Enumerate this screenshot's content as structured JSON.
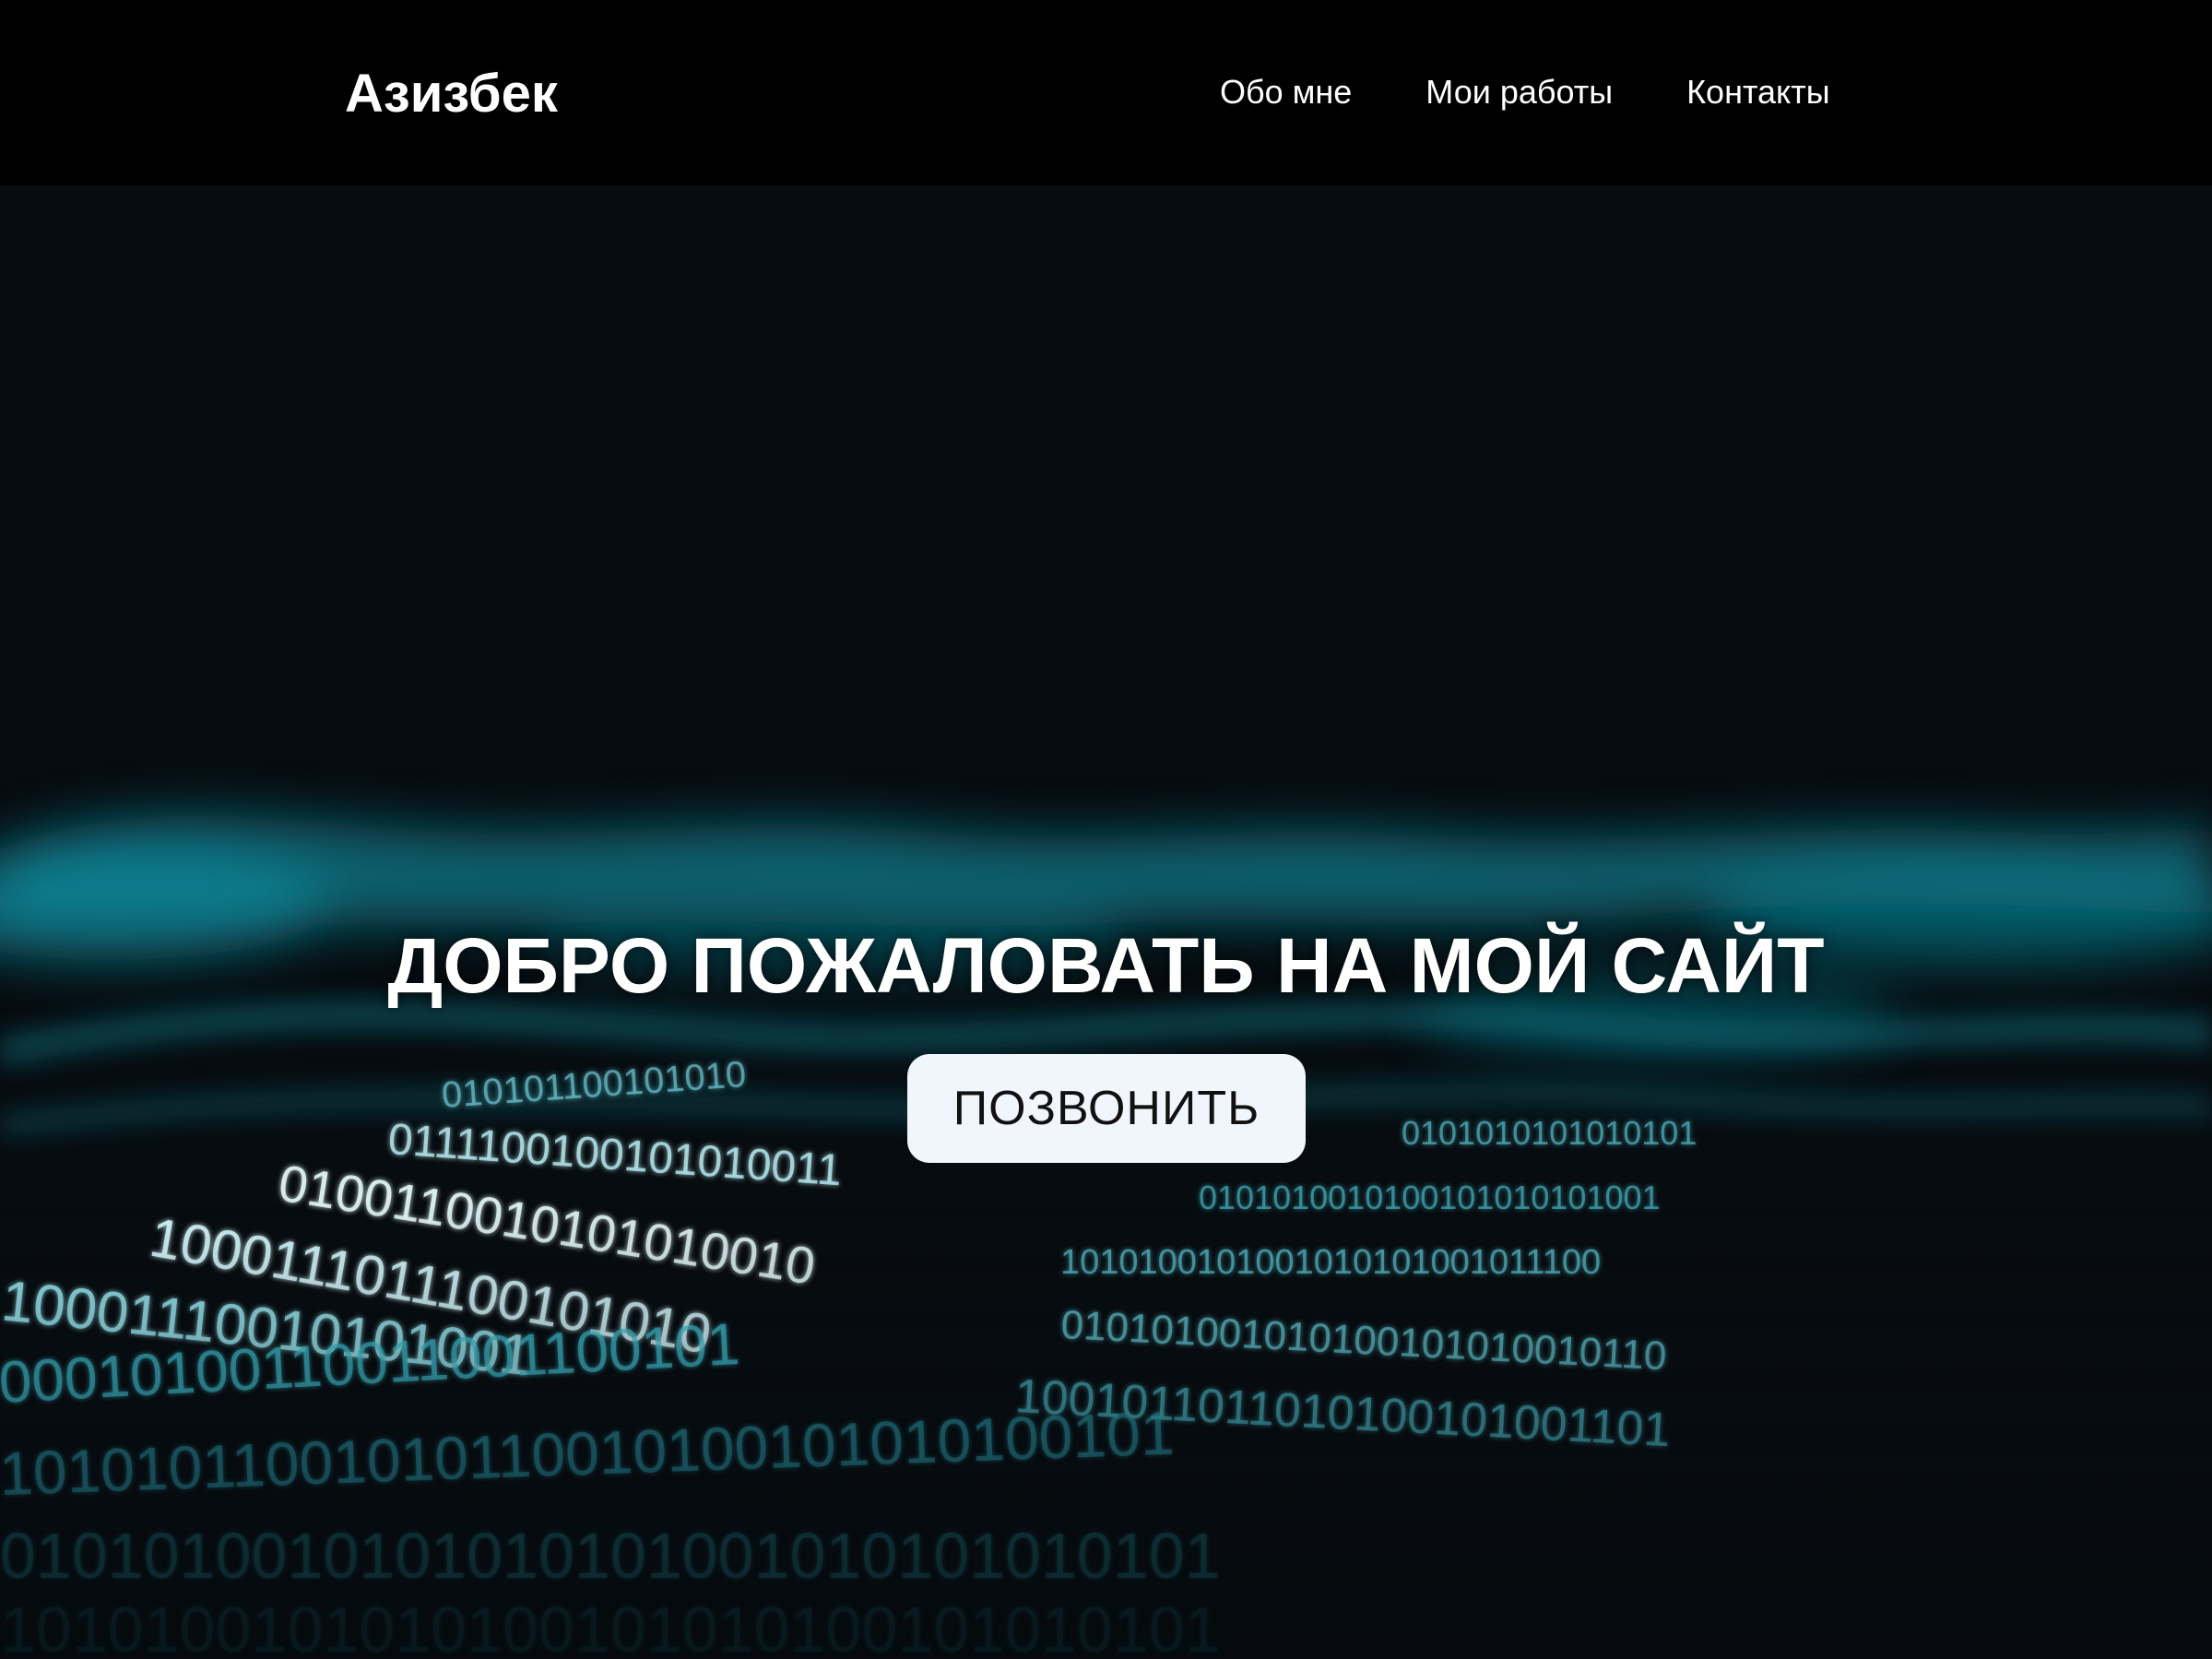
{
  "header": {
    "logo": "Азизбек",
    "nav": [
      {
        "label": "Обо мне"
      },
      {
        "label": "Мои работы"
      },
      {
        "label": "Контакты"
      }
    ]
  },
  "hero": {
    "title": "ДОБРО ПОЖАЛОВАТЬ НА МОЙ САЙТ",
    "button_label": "ПОЗВОНИТЬ",
    "background": "binary-code-wave-image"
  },
  "colors": {
    "header_bg": "#000000",
    "hero_bg": "#070c10",
    "accent_cyan": "#1ec8d8",
    "button_bg": "#f1f6fd",
    "button_text": "#111111"
  }
}
